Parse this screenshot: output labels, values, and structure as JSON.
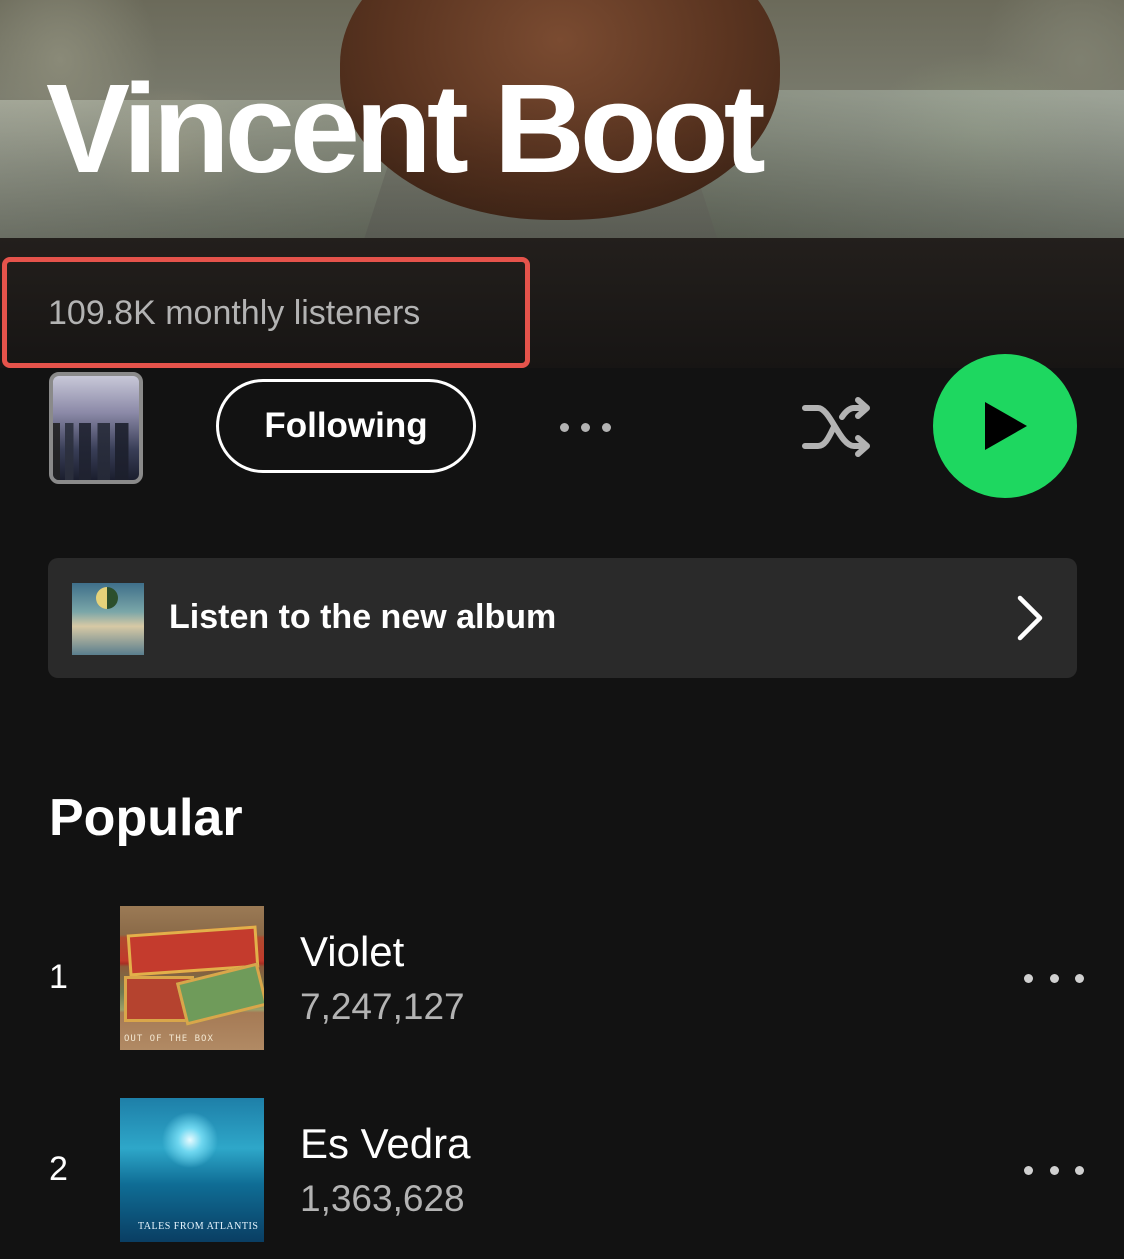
{
  "artist": {
    "name": "Vincent Boot",
    "monthly_listeners": "109.8K monthly listeners"
  },
  "controls": {
    "following_label": "Following",
    "more_icon": "ellipsis-icon",
    "shuffle_icon": "shuffle-icon",
    "play_icon": "play-icon",
    "play_color": "#1ed760"
  },
  "promo": {
    "label": "Listen to the new album",
    "chevron_icon": "chevron-right-icon"
  },
  "popular": {
    "title": "Popular",
    "tracks": [
      {
        "rank": "1",
        "title": "Violet",
        "plays": "7,247,127",
        "cover_caption": "OUT OF THE BOX"
      },
      {
        "rank": "2",
        "title": "Es Vedra",
        "plays": "1,363,628",
        "cover_caption": "TALES FROM ATLANTIS"
      }
    ]
  },
  "colors": {
    "background": "#121212",
    "highlight": "#e5534b",
    "secondary_text": "#b3b3b3",
    "banner_bg": "#2a2a2a"
  }
}
